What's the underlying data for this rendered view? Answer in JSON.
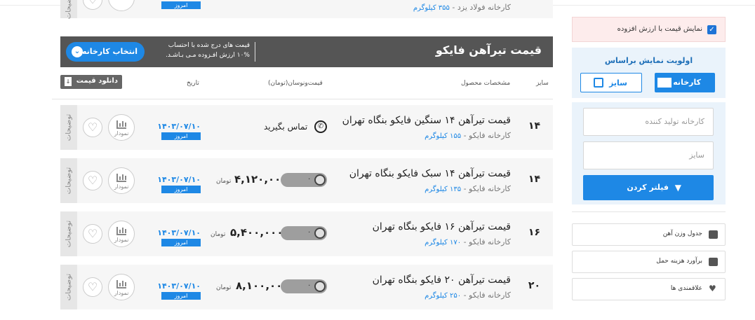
{
  "header_bar": {
    "title": "قیمت تیرآهن فایکو",
    "note_line1": "قیمت های درج شده با احتساب",
    "note_line2": "۱۰% ارزش افـزوده مـی بـاشـد.",
    "select_factory_label": "انتخاب کارخانه"
  },
  "table": {
    "download_label": "دانلود قیمت",
    "columns": {
      "size": "سایز",
      "specs": "مشخصات محصول",
      "price": "قیمت‌ونوسان(تومان)",
      "date": "تاریخ"
    },
    "partial_row": {
      "subtitle": "کارخانه فولاد یزد - ",
      "weight": "۳۵۵ کیلوگرم",
      "today": "امروز",
      "chart_label": "نمودار",
      "desc_label": "توضیحات"
    },
    "rows": [
      {
        "size": "۱۴",
        "title": "قیمت تیرآهن ۱۴ سنگین فایکو بنگاه تهران",
        "factory": "کارخانه فایکو - ",
        "weight": "۱۵۵ کیلوگرم",
        "price": "",
        "contact": "تماس بگیرید",
        "unit": "",
        "toggle": "",
        "date": "۱۴۰۳/۰۷/۱۰",
        "today": "امروز",
        "chart_label": "نمودار",
        "desc_label": "توضیحات"
      },
      {
        "size": "۱۴",
        "title": "قیمت تیرآهن ۱۴ سبک فایکو بنگاه تهران",
        "factory": "کارخانه فایکو - ",
        "weight": "۱۳۵ کیلوگرم",
        "price": "۴,۱۲۰,۰۰۰",
        "contact": "",
        "unit": "تومان",
        "toggle": "۰",
        "date": "۱۴۰۳/۰۷/۱۰",
        "today": "امروز",
        "chart_label": "نمودار",
        "desc_label": "توضیحات"
      },
      {
        "size": "۱۶",
        "title": "قیمت تیرآهن ۱۶ فایکو بنگاه تهران",
        "factory": "کارخانه فایکو - ",
        "weight": "۱۷۰ کیلوگرم",
        "price": "۵,۴۰۰,۰۰۰",
        "contact": "",
        "unit": "تومان",
        "toggle": "۰",
        "date": "۱۴۰۳/۰۷/۱۰",
        "today": "امروز",
        "chart_label": "نمودار",
        "desc_label": "توضیحات"
      },
      {
        "size": "۲۰",
        "title": "قیمت تیرآهن ۲۰ فایکو بنگاه تهران",
        "factory": "کارخانه فایکو - ",
        "weight": "۲۵۰ کیلوگرم",
        "price": "۸,۱۰۰,۰۰۰",
        "contact": "",
        "unit": "تومان",
        "toggle": "۰",
        "date": "۱۴۰۳/۰۷/۱۰",
        "today": "امروز",
        "chart_label": "نمودار",
        "desc_label": "توضیحات"
      }
    ]
  },
  "sidebar": {
    "vat_label": "نمایش قیمت با ارزش افزوده",
    "vat_checked": true,
    "priority_title": "اولویت نمایش براساس",
    "tab_factory": "کارخانه",
    "tab_size": "سایز",
    "producer_placeholder": "کارخانه تولید کننده",
    "size_placeholder": "سایز",
    "filter_button": "فیلتر کردن",
    "links": [
      {
        "label": "جدول وزن آهن",
        "icon": "camera-icon"
      },
      {
        "label": "برآورد هزینه حمل",
        "icon": "truck-icon"
      },
      {
        "label": "علاقمندی ها",
        "icon": "heart-icon"
      }
    ]
  },
  "colors": {
    "accent": "#1e88e5",
    "header_bg": "#555555",
    "vat_bg": "#fdecec"
  }
}
